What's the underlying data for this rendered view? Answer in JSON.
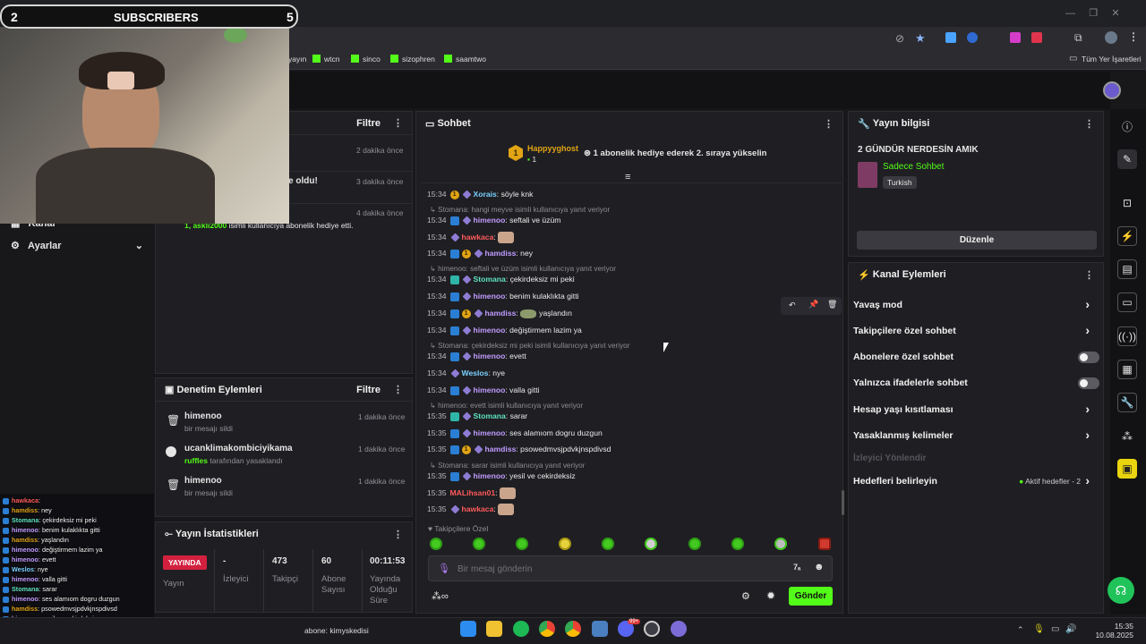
{
  "overlay": {
    "sub_left": "2",
    "sub_title": "SUBSCRIBERS",
    "sub_right": "5"
  },
  "bookmarks": [
    "yayın",
    "wtcn",
    "sinco",
    "sizophren",
    "saamtwo"
  ],
  "bookmarks_all": "Tüm Yer İşaretleri",
  "left_panel": {
    "filter_label": "Filtre",
    "activities": [
      {
        "time": "2 dakika önce"
      },
      {
        "text": "e oldu!",
        "time": "3 dakika önce"
      },
      {
        "time": "4 dakika önce",
        "user": "1, askli2000",
        "text": "isimli kullanıcıya abonelik hediye etti."
      }
    ],
    "nav_kanal": "Kanal",
    "nav_ayarlar": "Ayarlar"
  },
  "moderation": {
    "title": "Denetim Eylemleri",
    "filter_label": "Filtre",
    "items": [
      {
        "user": "himenoo",
        "desc": "bir mesajı sildi",
        "time": "1 dakika önce"
      },
      {
        "user": "ucanklimakombiciyikama",
        "by": "ruffles",
        "desc": "tarafından yasaklandı",
        "time": "1 dakika önce"
      },
      {
        "user": "himenoo",
        "desc": "bir mesajı sildi",
        "time": "1 dakika önce"
      }
    ]
  },
  "stats": {
    "title": "Yayın İstatistikleri",
    "live_badge": "YAYINDA",
    "live_label": "Yayın",
    "items": [
      {
        "value": "-",
        "label": "İzleyici"
      },
      {
        "value": "473",
        "label": "Takipçi"
      },
      {
        "value": "60",
        "label": "Abone Sayısı"
      },
      {
        "value": "00:11:53",
        "label": "Yayında Olduğu Süre"
      }
    ]
  },
  "chat": {
    "title": "Sohbet",
    "pinned_user": "Happyyghost",
    "pinned_rank": "1",
    "pinned_count": "1",
    "pinned_text": "1 abonelik hediye ederek 2. sıraya yükselin",
    "messages": [
      {
        "time": "15:34",
        "user": "Xorais",
        "color": "#7ad0ff",
        "text": "söyle knk"
      },
      {
        "reply": "Stomana: hangi meyve isimli kullanıcıya yanıt veriyor"
      },
      {
        "time": "15:34",
        "user": "himenoo",
        "color": "#c19bff",
        "text": "seftali ve üzüm"
      },
      {
        "time": "15:34",
        "user": "hawkaca",
        "color": "#ff5a5a",
        "text": ""
      },
      {
        "time": "15:34",
        "user": "hamdiss",
        "color": "#c19bff",
        "text": "ney"
      },
      {
        "reply": "himenoo: seftali ve üzüm isimli kullanıcıya yanıt veriyor"
      },
      {
        "time": "15:34",
        "user": "Stomana",
        "color": "#5ee2c0",
        "text": "çekirdeksiz mi peki"
      },
      {
        "time": "15:34",
        "user": "himenoo",
        "color": "#c19bff",
        "text": "benim kulaklıkta gitti"
      },
      {
        "time": "15:34",
        "user": "hamdiss",
        "color": "#c19bff",
        "text": "yaşlandın"
      },
      {
        "time": "15:34",
        "user": "himenoo",
        "color": "#c19bff",
        "text": "değiştirmem lazim ya"
      },
      {
        "reply": "Stomana: çekirdeksiz mi peki isimli kullanıcıya yanıt veriyor"
      },
      {
        "time": "15:34",
        "user": "himenoo",
        "color": "#c19bff",
        "text": "evett"
      },
      {
        "time": "15:34",
        "user": "Weslos",
        "color": "#7ad0ff",
        "text": "nye"
      },
      {
        "time": "15:34",
        "user": "himenoo",
        "color": "#c19bff",
        "text": "valla gitti"
      },
      {
        "reply": "himenoo: evett isimli kullanıcıya yanıt veriyor"
      },
      {
        "time": "15:35",
        "user": "Stomana",
        "color": "#5ee2c0",
        "text": "sarar"
      },
      {
        "time": "15:35",
        "user": "himenoo",
        "color": "#c19bff",
        "text": "ses alamıom dogru duzgun"
      },
      {
        "time": "15:35",
        "user": "hamdiss",
        "color": "#c19bff",
        "text": "psowedmvsjpdvkjnspdivsd"
      },
      {
        "reply": "Stomana: sarar isimli kullanıcıya yanıt veriyor"
      },
      {
        "time": "15:35",
        "user": "himenoo",
        "color": "#c19bff",
        "text": "yesil ve cekirdeksiz"
      },
      {
        "time": "15:35",
        "user": "MALihsan01",
        "color": "#ff5a5a",
        "text": ""
      },
      {
        "time": "15:35",
        "user": "hawkaca",
        "color": "#ff5a5a",
        "text": ""
      }
    ],
    "followers_only": "Takipçilere Özel",
    "input_placeholder": "Bir mesaj gönderin",
    "send_label": "Gönder"
  },
  "stream_info": {
    "title": "Yayın bilgisi",
    "stream_title": "2 GÜNDÜR NERDESİN AMIK",
    "category": "Sadece Sohbet",
    "language": "Turkish",
    "edit_label": "Düzenle"
  },
  "channel_actions": {
    "title": "Kanal Eylemleri",
    "items": [
      {
        "label": "Yavaş mod",
        "control": "chevron"
      },
      {
        "label": "Takipçilere özel sohbet",
        "control": "chevron"
      },
      {
        "label": "Abonelere özel sohbet",
        "control": "toggle"
      },
      {
        "label": "Yalnızca ifadelerle sohbet",
        "control": "toggle"
      },
      {
        "label": "Hesap yaşı kısıtlaması",
        "control": "chevron"
      },
      {
        "label": "Yasaklanmış kelimeler",
        "control": "chevron"
      }
    ],
    "disabled_item": "İzleyici Yönlendir",
    "targets_label": "Hedefleri belirleyin",
    "targets_status": "Aktif hedefler - 2"
  },
  "overlay_chat": [
    {
      "user": "hawkaca",
      "text": ":"
    },
    {
      "user": "hamdiss",
      "text": ": ney"
    },
    {
      "user": "Stomana",
      "text": ": çekirdeksiz mi peki"
    },
    {
      "user": "himenoo",
      "text": ": benim kulaklıkta gitti"
    },
    {
      "user": "hamdiss",
      "text": ": yaşlandın"
    },
    {
      "user": "himenoo",
      "text": ": değiştirmem lazim ya"
    },
    {
      "user": "himenoo",
      "text": ": evett"
    },
    {
      "user": "Weslos",
      "text": ": nye"
    },
    {
      "user": "himenoo",
      "text": ": valla gitti"
    },
    {
      "user": "Stomana",
      "text": ": sarar"
    },
    {
      "user": "himenoo",
      "text": ": ses alamıom dogru duzgun"
    },
    {
      "user": "hamdiss",
      "text": ": psowedmvsjpdvkjnspdivsd"
    },
    {
      "user": "himenoo",
      "text": ": yesil ve cekirdeksiz"
    },
    {
      "user": "MALihsan01",
      "text": ":"
    }
  ],
  "taskbar": {
    "ticker": "abone: kimyskedisi",
    "time": "15:35",
    "date": "10.08.2025",
    "badge": "99+"
  },
  "colors": {
    "accent": "#53fc18",
    "panel": "#1f1f23",
    "background": "#18181b"
  }
}
